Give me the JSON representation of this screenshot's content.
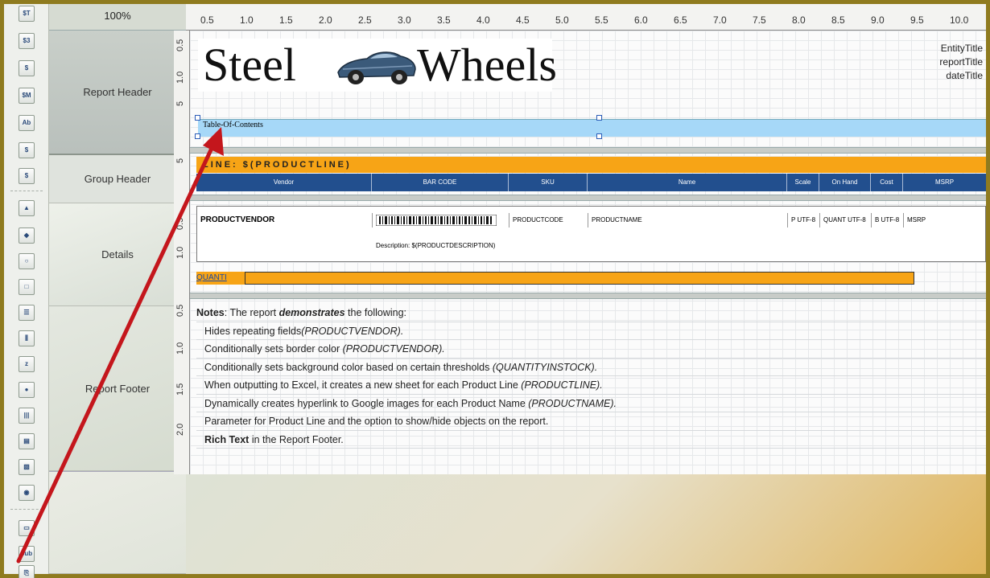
{
  "zoom": "100%",
  "toolbar": {
    "items": [
      {
        "label": "$T",
        "icon": "dollar-t-icon"
      },
      {
        "label": "$3",
        "icon": "dollar-field-icon"
      },
      {
        "label": "$",
        "icon": "dollar-function-icon"
      },
      {
        "label": "$M",
        "icon": "dollar-message-icon"
      },
      {
        "label": "Ab",
        "icon": "label-text-icon"
      },
      {
        "label": "$",
        "icon": "resource-field-icon"
      },
      {
        "label": "$",
        "icon": "resource-label-icon"
      },
      {
        "label": "▲",
        "icon": "chart-icon"
      },
      {
        "label": "◆",
        "icon": "shapes-icon"
      },
      {
        "label": "○",
        "icon": "ellipse-icon"
      },
      {
        "label": "□",
        "icon": "rectangle-icon"
      },
      {
        "label": "☰",
        "icon": "horizontal-band-icon"
      },
      {
        "label": "⫼",
        "icon": "vertical-band-icon"
      },
      {
        "label": "z",
        "icon": "line-icon"
      },
      {
        "label": "●",
        "icon": "image-field-icon"
      },
      {
        "label": "|||",
        "icon": "barcode-icon"
      },
      {
        "label": "▤",
        "icon": "text-document-icon"
      },
      {
        "label": "▧",
        "icon": "image-document-icon"
      },
      {
        "label": "◉",
        "icon": "drawable-field-icon"
      },
      {
        "label": "▭",
        "icon": "band-icon"
      },
      {
        "label": "sub",
        "icon": "subreport-icon"
      },
      {
        "label": "⎘",
        "icon": "table-of-contents-icon"
      }
    ]
  },
  "bands": {
    "report_header": "Report Header",
    "group_header": "Group Header",
    "details": "Details",
    "report_footer": "Report Footer"
  },
  "ruler": {
    "top": [
      "0.5",
      "1.0",
      "1.5",
      "2.0",
      "2.5",
      "3.0",
      "3.5",
      "4.0",
      "4.5",
      "5.0",
      "5.5",
      "6.0",
      "6.5",
      "7.0",
      "7.5",
      "8.0",
      "8.5",
      "9.0",
      "9.5",
      "10.0"
    ],
    "left": [
      "0.5",
      "1.0",
      "5",
      "5",
      "0.5",
      "1.0",
      "0.5",
      "1.0",
      "1.5",
      "2.0"
    ]
  },
  "report": {
    "logo_left": "Steel",
    "logo_right": "Wheels",
    "title_fields": [
      "EntityTitle",
      "reportTitle",
      "dateTitle"
    ],
    "toc_label": "Table-Of-Contents",
    "group_line": "LINE: $(PRODUCTLINE)",
    "columns": [
      "Vendor",
      "BAR CODE",
      "SKU",
      "Name",
      "Scale",
      "On Hand",
      "Cost",
      "MSRP"
    ],
    "row": {
      "vendor": "PRODUCTVENDOR",
      "sku": "PRODUCTCODE",
      "name": "PRODUCTNAME",
      "scale": "P UTF-8",
      "on_hand": "QUANT UTF-8",
      "cost": "B UTF-8",
      "msrp": "MSRP",
      "description": "Description: $(PRODUCTDESCRIPTION)"
    },
    "quantity_label": "QUANTI"
  },
  "notes": {
    "intro_bold": "Notes",
    "intro_text": ":  The report ",
    "intro_em": "demonstrates",
    "intro_end": " the following:",
    "items": [
      {
        "text": "Hides repeating fields",
        "em": "(PRODUCTVENDOR)."
      },
      {
        "text": "Conditionally sets border color ",
        "em": "(PRODUCTVENDOR)."
      },
      {
        "text": "Conditionally sets background color based on certain thresholds ",
        "em": "(QUANTITYINSTOCK)."
      },
      {
        "text": "When outputting to Excel, it creates a new sheet for each Product Line ",
        "em": "(PRODUCTLINE)."
      },
      {
        "text": "Dynamically creates hyperlink to Google images for each Product Name ",
        "em": "(PRODUCTNAME)."
      },
      {
        "text": "Parameter for  Product Line and the option to show/hide objects on the report.",
        "em": ""
      }
    ],
    "last_bold": "Rich Text",
    "last_text": " in the Report Footer."
  },
  "colors": {
    "accent_orange": "#f7a416",
    "header_blue": "#224f8e",
    "toc_blue": "#a6d8f8",
    "arrow_red": "#c4161c"
  }
}
